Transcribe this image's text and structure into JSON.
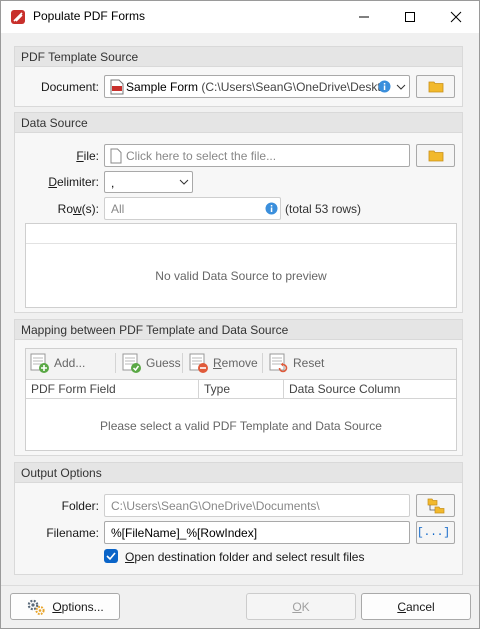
{
  "window": {
    "title": "Populate PDF Forms"
  },
  "template_source": {
    "header": "PDF Template Source",
    "document_label": "Document:",
    "document_value": "Sample Form",
    "document_path": "(C:\\Users\\SeanG\\OneDrive\\Desktop"
  },
  "data_source": {
    "header": "Data Source",
    "file_label": "File:",
    "file_placeholder": "Click here to select the file...",
    "delimiter_label": "Delimiter:",
    "delimiter_value": ",",
    "rows_label": "Row(s):",
    "rows_value": "All",
    "rows_total": "(total 53 rows)",
    "preview_message": "No valid Data Source to preview"
  },
  "mapping": {
    "header": "Mapping between PDF Template and Data Source",
    "toolbar": {
      "add": "Add...",
      "guess": "Guess",
      "remove": "Remove",
      "reset": "Reset"
    },
    "columns": [
      "PDF Form Field",
      "Type",
      "Data Source Column"
    ],
    "empty_message": "Please select a valid PDF Template and Data Source"
  },
  "output": {
    "header": "Output Options",
    "folder_label": "Folder:",
    "folder_value": "C:\\Users\\SeanG\\OneDrive\\Documents\\",
    "filename_label": "Filename:",
    "filename_value": "%[FileName]_%[RowIndex]",
    "macro_button": "[...]",
    "open_checkbox_label": "Open destination folder and select result files",
    "open_checked": true
  },
  "footer": {
    "options": "Options...",
    "ok": "OK",
    "cancel": "Cancel"
  },
  "colors": {
    "accent": "#0a64c8",
    "folder": "#f2b92c",
    "pdf_red": "#c8302c"
  }
}
